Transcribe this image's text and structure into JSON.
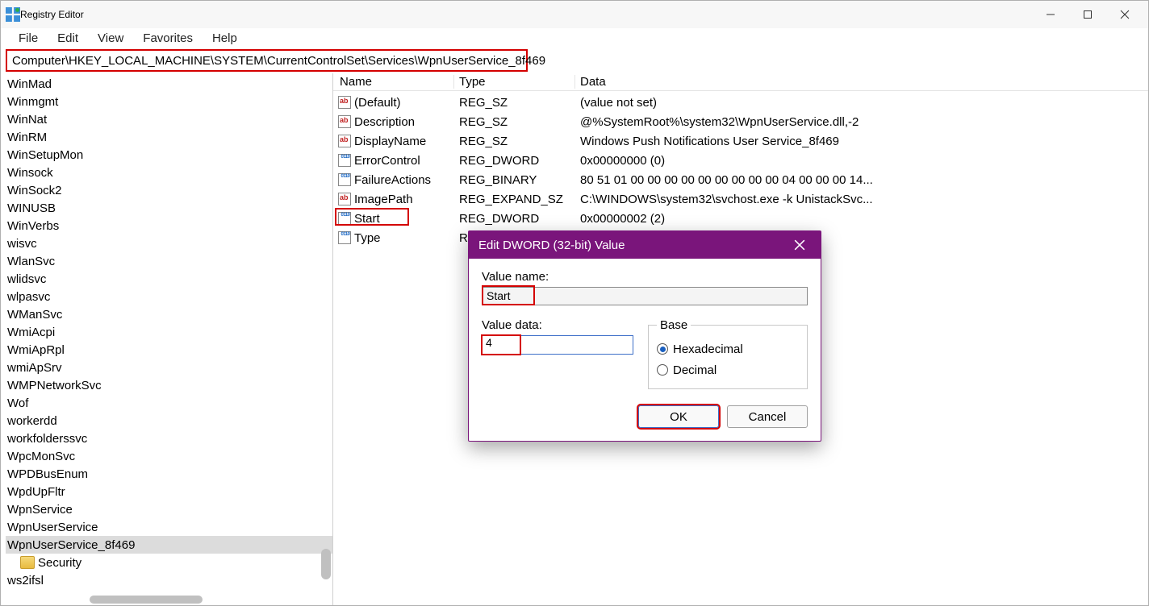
{
  "window": {
    "title": "Registry Editor"
  },
  "menu": {
    "file": "File",
    "edit": "Edit",
    "view": "View",
    "favorites": "Favorites",
    "help": "Help"
  },
  "address": "Computer\\HKEY_LOCAL_MACHINE\\SYSTEM\\CurrentControlSet\\Services\\WpnUserService_8f469",
  "tree": {
    "items": [
      "WinMad",
      "Winmgmt",
      "WinNat",
      "WinRM",
      "WinSetupMon",
      "Winsock",
      "WinSock2",
      "WINUSB",
      "WinVerbs",
      "wisvc",
      "WlanSvc",
      "wlidsvc",
      "wlpasvc",
      "WManSvc",
      "WmiAcpi",
      "WmiApRpl",
      "wmiApSrv",
      "WMPNetworkSvc",
      "Wof",
      "workerdd",
      "workfolderssvc",
      "WpcMonSvc",
      "WPDBusEnum",
      "WpdUpFltr",
      "WpnService",
      "WpnUserService",
      "WpnUserService_8f469",
      "Security",
      "ws2ifsl"
    ],
    "selected_index": 26,
    "folder_index": 27
  },
  "list": {
    "columns": {
      "name": "Name",
      "type": "Type",
      "data": "Data"
    },
    "rows": [
      {
        "icon": "sz",
        "name": "(Default)",
        "type": "REG_SZ",
        "data": "(value not set)"
      },
      {
        "icon": "sz",
        "name": "Description",
        "type": "REG_SZ",
        "data": "@%SystemRoot%\\system32\\WpnUserService.dll,-2"
      },
      {
        "icon": "sz",
        "name": "DisplayName",
        "type": "REG_SZ",
        "data": "Windows Push Notifications User Service_8f469"
      },
      {
        "icon": "dw",
        "name": "ErrorControl",
        "type": "REG_DWORD",
        "data": "0x00000000 (0)"
      },
      {
        "icon": "dw",
        "name": "FailureActions",
        "type": "REG_BINARY",
        "data": "80 51 01 00 00 00 00 00 00 00 00 00 04 00 00 00 14..."
      },
      {
        "icon": "sz",
        "name": "ImagePath",
        "type": "REG_EXPAND_SZ",
        "data": "C:\\WINDOWS\\system32\\svchost.exe -k UnistackSvc..."
      },
      {
        "icon": "dw",
        "name": "Start",
        "type": "REG_DWORD",
        "data": "0x00000002 (2)"
      },
      {
        "icon": "dw",
        "name": "Type",
        "type": "REG",
        "data": ""
      }
    ],
    "highlighted_row": 6
  },
  "dialog": {
    "title": "Edit DWORD (32-bit) Value",
    "value_name_label": "Value name:",
    "value_name": "Start",
    "value_data_label": "Value data:",
    "value_data": "4",
    "base_label": "Base",
    "hex_label": "Hexadecimal",
    "dec_label": "Decimal",
    "base_selected": "hex",
    "ok": "OK",
    "cancel": "Cancel"
  }
}
